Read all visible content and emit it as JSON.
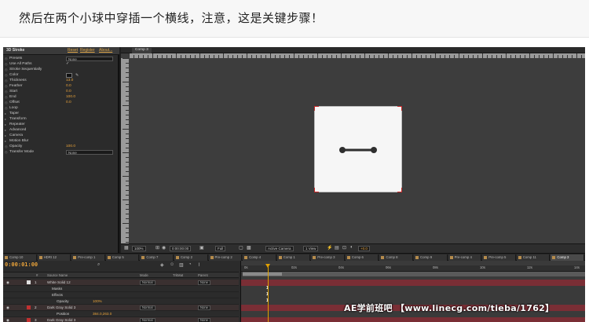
{
  "caption": "然后在两个小球中穿插一个横线，注意，这是关键步骤！",
  "effect_panel": {
    "effect_name": "3D Stroke",
    "links": [
      "Reset",
      "Register",
      "About..."
    ],
    "rows": [
      {
        "label": "Presets",
        "type": "select",
        "value": "None"
      },
      {
        "label": "Use All Paths",
        "type": "check",
        "value": "✓"
      },
      {
        "label": "Stroke Sequentially",
        "type": "plain",
        "value": ""
      },
      {
        "label": "Color",
        "type": "color",
        "value": ""
      },
      {
        "label": "Thickness",
        "type": "num",
        "value": "13.0"
      },
      {
        "label": "Feather",
        "type": "num",
        "value": "0.0"
      },
      {
        "label": "Start",
        "type": "num",
        "value": "0.0"
      },
      {
        "label": "End",
        "type": "num",
        "value": "100.0"
      },
      {
        "label": "Offset",
        "type": "num",
        "value": "0.0"
      },
      {
        "label": "Loop",
        "type": "check",
        "value": ""
      },
      {
        "label": "Taper",
        "type": "group",
        "value": ""
      },
      {
        "label": "Transform",
        "type": "group",
        "value": ""
      },
      {
        "label": "Repeater",
        "type": "group",
        "value": ""
      },
      {
        "label": "Advanced",
        "type": "group",
        "value": ""
      },
      {
        "label": "Camera",
        "type": "group",
        "value": ""
      },
      {
        "label": "Motion Blur",
        "type": "group",
        "value": ""
      },
      {
        "label": "Opacity",
        "type": "num",
        "value": "100.0"
      },
      {
        "label": "Transfer Mode",
        "type": "select",
        "value": "None"
      }
    ]
  },
  "composition": {
    "tab_label": "Comp 3",
    "canvas_bg": "#f6f6f6",
    "stroke_color": "#2f2f2f",
    "corner_color": "#c62828",
    "toolbar": {
      "zoom": "100%",
      "timecode": "0:00:00:00",
      "resolution": "Full",
      "camera": "Active Camera",
      "views": "1 View",
      "exposure": "+0.0"
    }
  },
  "timeline_tabs": [
    {
      "label": "Comp 10",
      "active": false
    },
    {
      "label": "HDRI 12",
      "active": false
    },
    {
      "label": "Pre-comp 1",
      "active": false
    },
    {
      "label": "Comp 5",
      "active": false
    },
    {
      "label": "Comp 7",
      "active": false
    },
    {
      "label": "Comp 2",
      "active": false
    },
    {
      "label": "Pre-comp 2",
      "active": false
    },
    {
      "label": "Comp 4",
      "active": false
    },
    {
      "label": "Comp 1",
      "active": false
    },
    {
      "label": "Pre-comp 3",
      "active": false
    },
    {
      "label": "Comp 6",
      "active": false
    },
    {
      "label": "Comp 8",
      "active": false
    },
    {
      "label": "Comp 9",
      "active": false
    },
    {
      "label": "Pre-comp 4",
      "active": false
    },
    {
      "label": "Pre-comp 5",
      "active": false
    },
    {
      "label": "Comp 11",
      "active": false
    },
    {
      "label": "Comp 3",
      "active": true
    }
  ],
  "timeline": {
    "current_time": "0:00:01:00",
    "headers": [
      "#",
      "Source Name",
      "Mode",
      "TrkMat",
      "Parent"
    ],
    "ruler_ticks": [
      "0s",
      "02s",
      "04s",
      "06s",
      "08s",
      "10s",
      "12s",
      "14s"
    ],
    "layers": [
      {
        "num": "1",
        "name": "White Solid 12",
        "color": "#e0e0e0",
        "indent": 0,
        "mode": "Normal",
        "parent": "None",
        "red": true
      },
      {
        "num": "",
        "name": "Masks",
        "color": "",
        "indent": 1,
        "mode": "",
        "parent": "",
        "red": false
      },
      {
        "num": "",
        "name": "Effects",
        "color": "",
        "indent": 1,
        "mode": "",
        "parent": "",
        "red": false
      },
      {
        "num": "",
        "name": "Opacity",
        "color": "",
        "indent": 2,
        "mode": "",
        "parent": "",
        "red": false,
        "value": "100%"
      },
      {
        "num": "2",
        "name": "Dark Gray Solid 3",
        "color": "#c23030",
        "indent": 0,
        "mode": "Normal",
        "parent": "None",
        "red": true
      },
      {
        "num": "",
        "name": "Position",
        "color": "",
        "indent": 2,
        "mode": "",
        "parent": "",
        "red": false,
        "value": "384.0,263.0"
      },
      {
        "num": "3",
        "name": "Dark Gray Solid 3",
        "color": "#c23030",
        "indent": 0,
        "mode": "Normal",
        "parent": "None",
        "red": true
      }
    ],
    "keyframe_marks": [
      "1",
      "1",
      "1"
    ]
  },
  "watermark": "AE学前班吧 【www.linecg.com/tieba/1762】"
}
